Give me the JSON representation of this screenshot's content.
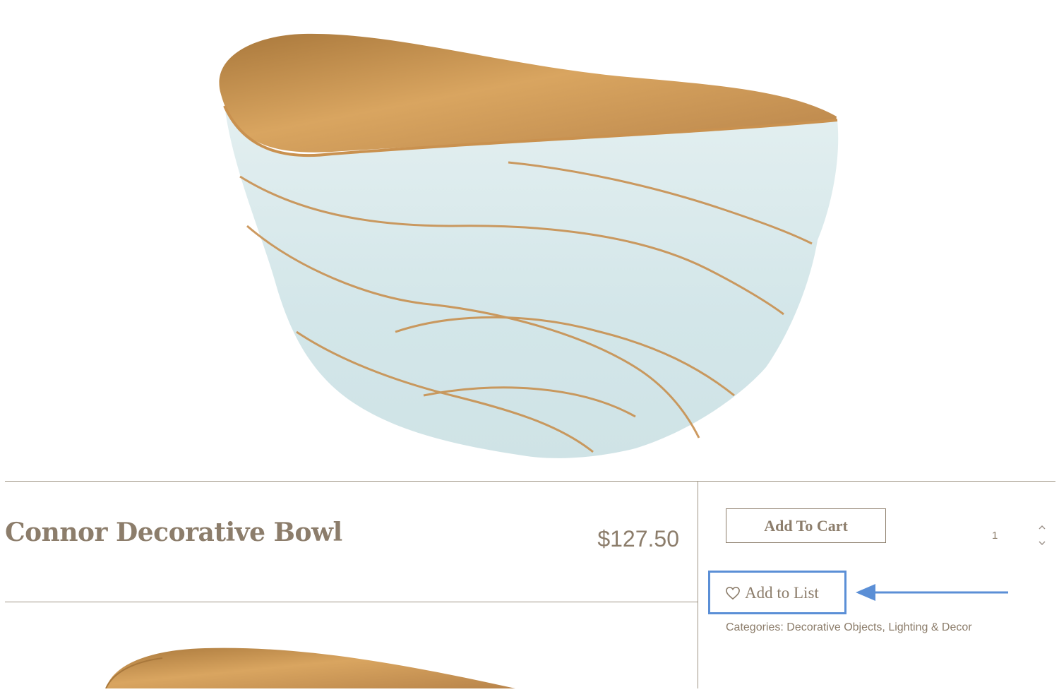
{
  "product": {
    "title": "Connor Decorative Bowl",
    "price": "$127.50",
    "image_alt": "Connor Decorative Bowl product photo"
  },
  "actions": {
    "add_to_cart_label": "Add To Cart",
    "quantity": "1",
    "add_to_list_label": "Add to List"
  },
  "categories": {
    "text": "Categories: Decorative Objects, Lighting & Decor"
  },
  "annotation": {
    "highlight_color": "#5b8fd6"
  },
  "colors": {
    "text_brown": "#8c7d6b",
    "bowl_gold": "#c18a4b",
    "bowl_blue": "#d5e7ea"
  }
}
